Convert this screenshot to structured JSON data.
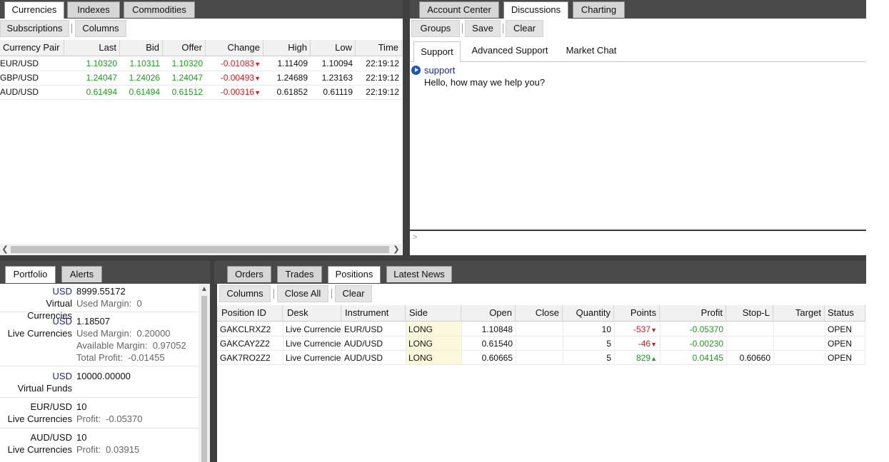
{
  "top_left": {
    "tabs": [
      "Currencies",
      "Indexes",
      "Commodities"
    ],
    "buttons": [
      "Subscriptions",
      "Columns"
    ],
    "columns": [
      "Currency Pair",
      "Last",
      "Bid",
      "Offer",
      "Change",
      "High",
      "Low",
      "Time"
    ],
    "rows": [
      {
        "pair": "EUR/USD",
        "last": "1.10320",
        "bid": "1.10311",
        "offer": "1.10320",
        "change": "-0.01083",
        "high": "1.11409",
        "low": "1.10094",
        "time": "22:19:12"
      },
      {
        "pair": "GBP/USD",
        "last": "1.24047",
        "bid": "1.24026",
        "offer": "1.24047",
        "change": "-0.00493",
        "high": "1.24689",
        "low": "1.23163",
        "time": "22:19:12"
      },
      {
        "pair": "AUD/USD",
        "last": "0.61494",
        "bid": "0.61494",
        "offer": "0.61512",
        "change": "-0.00316",
        "high": "0.61852",
        "low": "0.61119",
        "time": "22:19:12"
      }
    ],
    "down_arrow": "▼"
  },
  "top_right": {
    "tabs": [
      "Account Center",
      "Discussions",
      "Charting"
    ],
    "buttons": [
      "Groups",
      "Save",
      "Clear"
    ],
    "sub_tabs": [
      "Support",
      "Advanced Support",
      "Market Chat"
    ],
    "message": {
      "author": "support",
      "text": "Hello, how may we help you?"
    },
    "input_prompt": ">"
  },
  "bottom_left": {
    "tabs": [
      "Portfolio",
      "Alerts"
    ],
    "items": [
      {
        "currency": "USD",
        "name": "Virtual Currencies",
        "value": "8999.55172",
        "lines": [
          "Used Margin:  0"
        ]
      },
      {
        "currency": "USD",
        "name": "Live Currencies",
        "value": "1.18507",
        "lines": [
          "Used Margin:  0.20000",
          "Available Margin:  0.97052",
          "Total Profit:  -0.01455"
        ]
      },
      {
        "currency": "USD",
        "name": "Virtual Funds",
        "value": "10000.00000",
        "lines": []
      },
      {
        "currency": "EUR/USD",
        "name": "Live Currencies",
        "value": "10",
        "lines": [
          "Profit:  -0.05370"
        ]
      },
      {
        "currency": "AUD/USD",
        "name": "Live Currencies",
        "value": "10",
        "lines": [
          "Profit:  0.03915"
        ]
      }
    ]
  },
  "bottom_right": {
    "tabs": [
      "Orders",
      "Trades",
      "Positions",
      "Latest News"
    ],
    "buttons": [
      "Columns",
      "Close All",
      "Clear"
    ],
    "columns": [
      "Position ID",
      "Desk",
      "Instrument",
      "Side",
      "Open",
      "Close",
      "Quantity",
      "Points",
      "Profit",
      "Stop-L",
      "Target",
      "Status"
    ],
    "rows": [
      {
        "id": "GAKCLRXZ2",
        "desk": "Live Currencies",
        "instrument": "EUR/USD",
        "side": "LONG",
        "open": "1.10848",
        "close": "",
        "quantity": "10",
        "points": "-537",
        "points_arrow": "▼",
        "profit": "-0.05370",
        "stop": "",
        "target": "",
        "status": "OPEN"
      },
      {
        "id": "GAKCAY2Z2",
        "desk": "Live Currencies",
        "instrument": "AUD/USD",
        "side": "LONG",
        "open": "0.61540",
        "close": "",
        "quantity": "5",
        "points": "-46",
        "points_arrow": "▼",
        "profit": "-0.00230",
        "stop": "",
        "target": "",
        "status": "OPEN"
      },
      {
        "id": "GAK7RO2Z2",
        "desk": "Live Currencies",
        "instrument": "AUD/USD",
        "side": "LONG",
        "open": "0.60665",
        "close": "",
        "quantity": "5",
        "points": "829",
        "points_arrow": "▲",
        "profit": "0.04145",
        "stop": "0.60660",
        "target": "",
        "status": "OPEN"
      }
    ]
  },
  "colors": {
    "up": "#1e9b1e",
    "down": "#d11e1e",
    "header_blue": "#1f2a8c",
    "long_bg": "#fbf8dc"
  }
}
